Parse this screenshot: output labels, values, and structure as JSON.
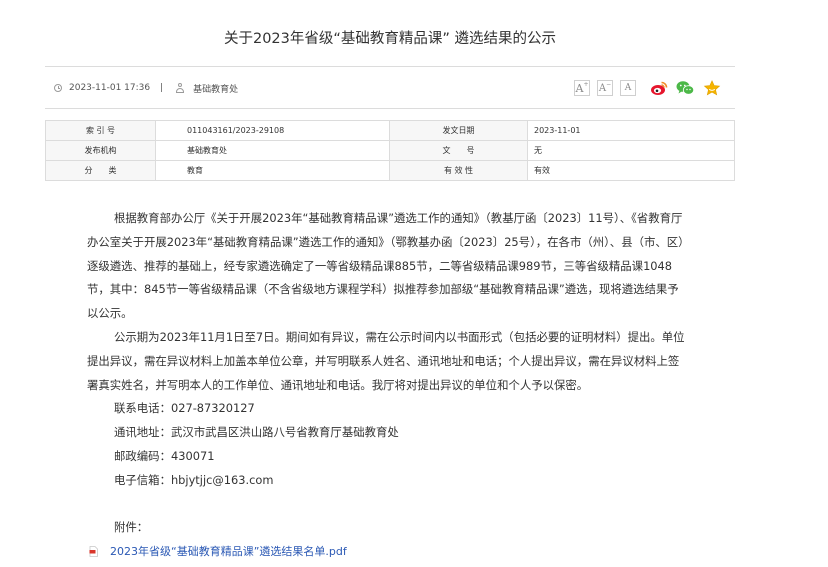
{
  "article": {
    "title": "关于2023年省级“基础教育精品课” 遴选结果的公示",
    "date": "2023-11-01 17:36",
    "separator": "|",
    "publisher": "基础教育处"
  },
  "toolbar": {
    "font_large": "A",
    "font_medium": "A",
    "font_small": "A",
    "icons": {
      "clock": "clock-icon",
      "user": "user-icon",
      "weibo": "weibo-share-icon",
      "wechat": "wechat-share-icon",
      "favorite": "star-favorite-icon"
    },
    "colors": {
      "weibo": "#e6162d",
      "wechat": "#4cb848",
      "star": "#f5b400",
      "link": "#2a58b4"
    }
  },
  "info_table": {
    "rows": [
      {
        "k1": "索 引 号",
        "v1": "011043161/2023-29108",
        "k2": "发文日期",
        "v2": "2023-11-01"
      },
      {
        "k1": "发布机构",
        "v1": "基础教育处",
        "k2": "文　　号",
        "v2": "无"
      },
      {
        "k1": "分　　类",
        "v1": "教育",
        "k2": "有 效 性",
        "v2": "有效"
      }
    ]
  },
  "body": {
    "para1": "根据教育部办公厅《关于开展2023年“基础教育精品课”遴选工作的通知》（教基厅函〔2023〕11号）、《省教育厅办公室关于开展2023年“基础教育精品课”遴选工作的通知》（鄂教基办函〔2023〕25号），在各市（州）、县（市、区）逐级遴选、推荐的基础上，经专家遴选确定了一等省级精品课885节，二等省级精品课989节，三等省级精品课1048节，其中：845节一等省级精品课（不含省级地方课程学科）拟推荐参加部级“基础教育精品课”遴选，现将遴选结果予以公示。",
    "para2": "公示期为2023年11月1日至7日。期间如有异议，需在公示时间内以书面形式（包括必要的证明材料）提出。单位提出异议，需在异议材料上加盖本单位公章，并写明联系人姓名、通讯地址和电话；个人提出异议，需在异议材料上签署真实姓名，并写明本人的工作单位、通讯地址和电话。我厅将对提出异议的单位和个人予以保密。",
    "phone": "联系电话：027-87320127",
    "address": "通讯地址：武汉市武昌区洪山路八号省教育厅基础教育处",
    "postcode": "邮政编码：430071",
    "email": "电子信箱：hbjytjjc@163.com",
    "attachment_label": "附件：",
    "attachment_file": "2023年省级“基础教育精品课”遴选结果名单.pdf"
  }
}
